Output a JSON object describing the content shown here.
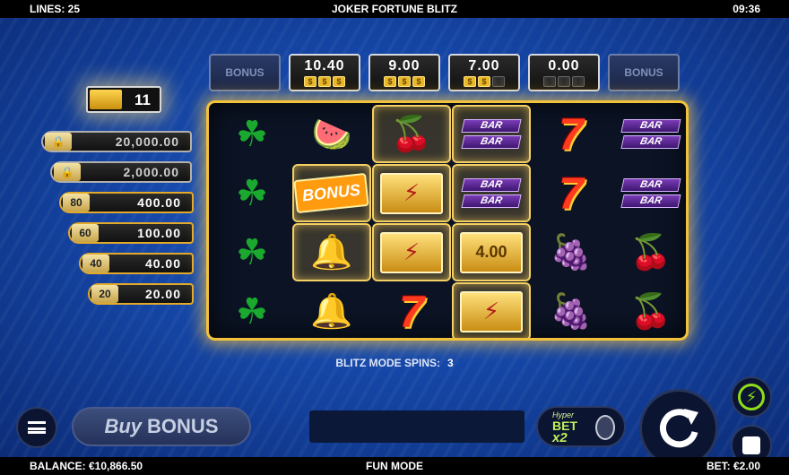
{
  "topbar": {
    "lines": "LINES: 25",
    "title": "JOKER FORTUNE BLITZ",
    "time": "09:36"
  },
  "bottombar": {
    "balance": "BALANCE: €10,866.50",
    "mode": "FUN MODE",
    "bet": "BET: €2.00"
  },
  "jackpots": [
    {
      "value": "BONUS",
      "state": "empty",
      "coins": []
    },
    {
      "value": "10.40",
      "state": "active",
      "coins": [
        true,
        true,
        true
      ]
    },
    {
      "value": "9.00",
      "state": "active",
      "coins": [
        true,
        true,
        true
      ]
    },
    {
      "value": "7.00",
      "state": "active",
      "coins": [
        true,
        true,
        false
      ]
    },
    {
      "value": "0.00",
      "state": "active",
      "coins": [
        false,
        false,
        false
      ]
    },
    {
      "value": "BONUS",
      "state": "empty",
      "coins": []
    }
  ],
  "ladder": {
    "current": "11",
    "rungs": [
      {
        "tag": "🔒",
        "value": "20,000.00",
        "style": "grey"
      },
      {
        "tag": "🔒",
        "value": "2,000.00",
        "style": "grey"
      },
      {
        "tag": "80",
        "value": "400.00",
        "style": "gold"
      },
      {
        "tag": "60",
        "value": "100.00",
        "style": "gold"
      },
      {
        "tag": "40",
        "value": "40.00",
        "style": "gold"
      },
      {
        "tag": "20",
        "value": "20.00",
        "style": "gold"
      }
    ]
  },
  "reels": [
    [
      {
        "sym": "clover"
      },
      {
        "sym": "clover"
      },
      {
        "sym": "clover"
      },
      {
        "sym": "clover"
      }
    ],
    [
      {
        "sym": "melon"
      },
      {
        "sym": "bonus",
        "label": "BONUS",
        "held": true
      },
      {
        "sym": "bell",
        "held": true
      },
      {
        "sym": "bell"
      }
    ],
    [
      {
        "sym": "cherry",
        "held": true
      },
      {
        "sym": "gold",
        "held": true
      },
      {
        "sym": "gold",
        "held": true
      },
      {
        "sym": "seven",
        "label": "7"
      }
    ],
    [
      {
        "sym": "bar",
        "label": "BAR",
        "held": true
      },
      {
        "sym": "bar",
        "label": "BAR",
        "held": true
      },
      {
        "sym": "goldvalue",
        "label": "4.00",
        "held": true
      },
      {
        "sym": "gold",
        "held": true
      }
    ],
    [
      {
        "sym": "seven",
        "label": "7"
      },
      {
        "sym": "seven",
        "label": "7"
      },
      {
        "sym": "grape"
      },
      {
        "sym": "grape"
      }
    ],
    [
      {
        "sym": "bar",
        "label": "BAR"
      },
      {
        "sym": "bar",
        "label": "BAR"
      },
      {
        "sym": "cherry"
      },
      {
        "sym": "cherry"
      }
    ]
  ],
  "blitz": {
    "label": "BLITZ MODE SPINS:",
    "value": "3"
  },
  "controls": {
    "buy_bonus_a": "Buy",
    "buy_bonus_b": "BONUS",
    "hyper_t1": "Hyper",
    "hyper_t2": "BET",
    "hyper_t3": "x2"
  }
}
